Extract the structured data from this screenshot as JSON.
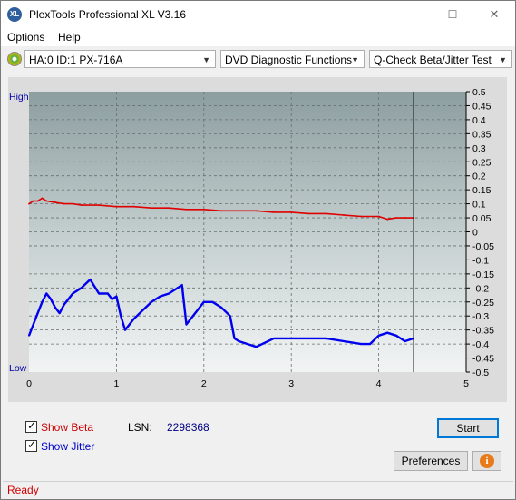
{
  "window": {
    "title": "PlexTools Professional XL V3.16",
    "icon": "xl-app-icon",
    "minimize": "—",
    "maximize": "☐",
    "close": "✕"
  },
  "menu": {
    "options": "Options",
    "help": "Help"
  },
  "toolbar": {
    "drive": "HA:0 ID:1  PX-716A",
    "function": "DVD Diagnostic Functions",
    "test": "Q-Check Beta/Jitter Test"
  },
  "chart_data": {
    "type": "line",
    "left_labels": {
      "high": "High",
      "low": "Low"
    },
    "x_ticks": [
      "0",
      "1",
      "2",
      "3",
      "4",
      "5"
    ],
    "x_range": [
      0,
      5
    ],
    "y_ticks": [
      "0.5",
      "0.45",
      "0.4",
      "0.35",
      "0.3",
      "0.25",
      "0.2",
      "0.15",
      "0.1",
      "0.05",
      "0",
      "-0.05",
      "-0.1",
      "-0.15",
      "-0.2",
      "-0.25",
      "-0.3",
      "-0.35",
      "-0.4",
      "-0.45",
      "-0.5"
    ],
    "y_range": [
      -0.5,
      0.5
    ],
    "marker_x": 4.4,
    "grid": true,
    "series": [
      {
        "color": "#e00000",
        "x": [
          0.0,
          0.05,
          0.1,
          0.15,
          0.2,
          0.3,
          0.4,
          0.5,
          0.6,
          0.8,
          1.0,
          1.2,
          1.4,
          1.6,
          1.8,
          2.0,
          2.2,
          2.4,
          2.6,
          2.8,
          3.0,
          3.2,
          3.4,
          3.6,
          3.8,
          4.0,
          4.1,
          4.2,
          4.3,
          4.4
        ],
        "y": [
          0.1,
          0.11,
          0.11,
          0.12,
          0.11,
          0.105,
          0.1,
          0.1,
          0.095,
          0.095,
          0.09,
          0.09,
          0.085,
          0.085,
          0.08,
          0.08,
          0.075,
          0.075,
          0.075,
          0.07,
          0.07,
          0.065,
          0.065,
          0.06,
          0.055,
          0.055,
          0.045,
          0.05,
          0.05,
          0.05
        ]
      },
      {
        "color": "#0000ee",
        "x": [
          0.0,
          0.05,
          0.1,
          0.15,
          0.2,
          0.25,
          0.3,
          0.35,
          0.4,
          0.5,
          0.6,
          0.7,
          0.8,
          0.9,
          0.95,
          1.0,
          1.05,
          1.1,
          1.2,
          1.3,
          1.4,
          1.5,
          1.6,
          1.7,
          1.75,
          1.8,
          1.9,
          2.0,
          2.1,
          2.2,
          2.3,
          2.35,
          2.4,
          2.5,
          2.6,
          2.8,
          3.0,
          3.2,
          3.4,
          3.6,
          3.8,
          3.9,
          4.0,
          4.1,
          4.2,
          4.3,
          4.4
        ],
        "y": [
          -0.37,
          -0.33,
          -0.29,
          -0.25,
          -0.22,
          -0.24,
          -0.27,
          -0.29,
          -0.26,
          -0.22,
          -0.2,
          -0.17,
          -0.22,
          -0.22,
          -0.24,
          -0.23,
          -0.3,
          -0.35,
          -0.31,
          -0.28,
          -0.25,
          -0.23,
          -0.22,
          -0.2,
          -0.19,
          -0.33,
          -0.29,
          -0.25,
          -0.25,
          -0.27,
          -0.3,
          -0.38,
          -0.39,
          -0.4,
          -0.41,
          -0.38,
          -0.38,
          -0.38,
          -0.38,
          -0.39,
          -0.4,
          -0.4,
          -0.37,
          -0.36,
          -0.37,
          -0.39,
          -0.38
        ]
      }
    ]
  },
  "bottom": {
    "show_beta": "Show Beta",
    "show_jitter": "Show Jitter",
    "lsn_label": "LSN:",
    "lsn_value": "2298368",
    "start": "Start",
    "preferences": "Preferences",
    "info_glyph": "i",
    "beta_color": "#cc0000",
    "jitter_color": "#0000cc"
  },
  "status": {
    "text": "Ready"
  }
}
